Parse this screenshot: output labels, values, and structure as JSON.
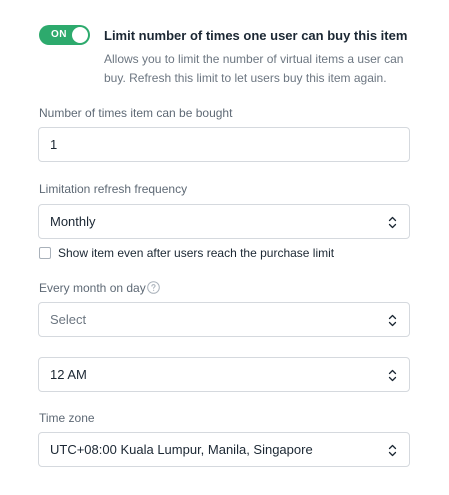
{
  "purchase_limit": {
    "toggle_label": "ON",
    "toggle_on": true,
    "title": "Limit number of times one user can buy this item",
    "description": "Allows you to limit the number of virtual items a user can buy. Refresh this limit to let users buy this item again."
  },
  "times_bought": {
    "label": "Number of times item can be bought",
    "value": "1"
  },
  "refresh_frequency": {
    "label": "Limitation refresh frequency",
    "value": "Monthly"
  },
  "show_item_checkbox": {
    "label": "Show item even after users reach the purchase limit",
    "checked": false
  },
  "month_day": {
    "label": "Every month on day",
    "placeholder": "Select"
  },
  "time": {
    "value": "12 AM"
  },
  "time_zone": {
    "label": "Time zone",
    "value": "UTC+08:00 Kuala Lumpur, Manila, Singapore"
  },
  "colors": {
    "toggle_on": "#2daa6d",
    "text_primary": "#1b2733",
    "text_secondary": "#6c7681",
    "border": "#d5d9de"
  },
  "icons": {
    "select_arrow": "chevron-up-down-icon",
    "help": "question-circle-icon"
  }
}
